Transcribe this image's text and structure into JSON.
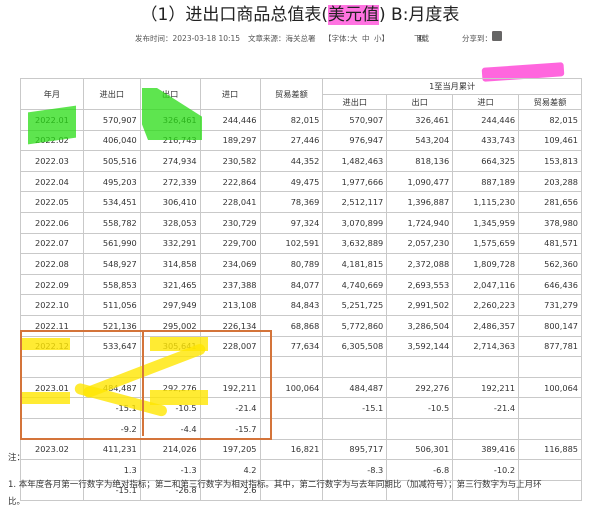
{
  "title": {
    "prefix": "（1）进出口商品总值表(",
    "highlight": "美元值",
    "suffix": ") B:月度表"
  },
  "meta": {
    "publish_time": "发布时间：2023-03-18 10:15",
    "source": "文章来源：海关总署",
    "font_label": "【字体：",
    "font_large": "大",
    "font_medium": "中",
    "font_small": "小】",
    "download": "下载",
    "share": "分享到："
  },
  "table": {
    "headers": {
      "month": "年月",
      "total": "进出口",
      "export": "出口",
      "import": "进口",
      "balance": "贸易差额",
      "cumulative_group": "1至当月累计",
      "cum_total": "进出口",
      "cum_export": "出口",
      "cum_import": "进口",
      "cum_balance": "贸易差额"
    },
    "rows": [
      {
        "month": "2022.01",
        "total": "570,907",
        "export": "326,461",
        "import": "244,446",
        "balance": "82,015",
        "cum_total": "570,907",
        "cum_export": "326,461",
        "cum_import": "244,446",
        "cum_balance": "82,015"
      },
      {
        "month": "2022.02",
        "total": "406,040",
        "export": "216,743",
        "import": "189,297",
        "balance": "27,446",
        "cum_total": "976,947",
        "cum_export": "543,204",
        "cum_import": "433,743",
        "cum_balance": "109,461"
      },
      {
        "month": "2022.03",
        "total": "505,516",
        "export": "274,934",
        "import": "230,582",
        "balance": "44,352",
        "cum_total": "1,482,463",
        "cum_export": "818,136",
        "cum_import": "664,325",
        "cum_balance": "153,813"
      },
      {
        "month": "2022.04",
        "total": "495,203",
        "export": "272,339",
        "import": "222,864",
        "balance": "49,475",
        "cum_total": "1,977,666",
        "cum_export": "1,090,477",
        "cum_import": "887,189",
        "cum_balance": "203,288"
      },
      {
        "month": "2022.05",
        "total": "534,451",
        "export": "306,410",
        "import": "228,041",
        "balance": "78,369",
        "cum_total": "2,512,117",
        "cum_export": "1,396,887",
        "cum_import": "1,115,230",
        "cum_balance": "281,656"
      },
      {
        "month": "2022.06",
        "total": "558,782",
        "export": "328,053",
        "import": "230,729",
        "balance": "97,324",
        "cum_total": "3,070,899",
        "cum_export": "1,724,940",
        "cum_import": "1,345,959",
        "cum_balance": "378,980"
      },
      {
        "month": "2022.07",
        "total": "561,990",
        "export": "332,291",
        "import": "229,700",
        "balance": "102,591",
        "cum_total": "3,632,889",
        "cum_export": "2,057,230",
        "cum_import": "1,575,659",
        "cum_balance": "481,571"
      },
      {
        "month": "2022.08",
        "total": "548,927",
        "export": "314,858",
        "import": "234,069",
        "balance": "80,789",
        "cum_total": "4,181,815",
        "cum_export": "2,372,088",
        "cum_import": "1,809,728",
        "cum_balance": "562,360"
      },
      {
        "month": "2022.09",
        "total": "558,853",
        "export": "321,465",
        "import": "237,388",
        "balance": "84,077",
        "cum_total": "4,740,669",
        "cum_export": "2,693,553",
        "cum_import": "2,047,116",
        "cum_balance": "646,436"
      },
      {
        "month": "2022.10",
        "total": "511,056",
        "export": "297,949",
        "import": "213,108",
        "balance": "84,843",
        "cum_total": "5,251,725",
        "cum_export": "2,991,502",
        "cum_import": "2,260,223",
        "cum_balance": "731,279"
      },
      {
        "month": "2022.11",
        "total": "521,136",
        "export": "295,002",
        "import": "226,134",
        "balance": "68,868",
        "cum_total": "5,772,860",
        "cum_export": "3,286,504",
        "cum_import": "2,486,357",
        "cum_balance": "800,147"
      },
      {
        "month": "2022.12",
        "total": "533,647",
        "export": "305,641",
        "import": "228,007",
        "balance": "77,634",
        "cum_total": "6,305,508",
        "cum_export": "3,592,144",
        "cum_import": "2,714,363",
        "cum_balance": "877,781"
      },
      {
        "month": "",
        "total": "",
        "export": "",
        "import": "",
        "balance": "",
        "cum_total": "",
        "cum_export": "",
        "cum_import": "",
        "cum_balance": ""
      },
      {
        "month": "2023.01",
        "total": "484,487",
        "export": "292,276",
        "import": "192,211",
        "balance": "100,064",
        "cum_total": "484,487",
        "cum_export": "292,276",
        "cum_import": "192,211",
        "cum_balance": "100,064"
      },
      {
        "month": "",
        "total": "-15.1",
        "export": "-10.5",
        "import": "-21.4",
        "balance": "",
        "cum_total": "-15.1",
        "cum_export": "-10.5",
        "cum_import": "-21.4",
        "cum_balance": ""
      },
      {
        "month": "",
        "total": "-9.2",
        "export": "-4.4",
        "import": "-15.7",
        "balance": "",
        "cum_total": "",
        "cum_export": "",
        "cum_import": "",
        "cum_balance": ""
      },
      {
        "month": "2023.02",
        "total": "411,231",
        "export": "214,026",
        "import": "197,205",
        "balance": "16,821",
        "cum_total": "895,717",
        "cum_export": "506,301",
        "cum_import": "389,416",
        "cum_balance": "116,885"
      },
      {
        "month": "",
        "total": "1.3",
        "export": "-1.3",
        "import": "4.2",
        "balance": "",
        "cum_total": "-8.3",
        "cum_export": "-6.8",
        "cum_import": "-10.2",
        "cum_balance": ""
      },
      {
        "month": "",
        "total": "-15.1",
        "export": "-26.8",
        "import": "2.6",
        "balance": "",
        "cum_total": "",
        "cum_export": "",
        "cum_import": "",
        "cum_balance": ""
      }
    ]
  },
  "notes": {
    "label": "注：",
    "line1": "1. 本年度各月第一行数字为绝对指标；第二和第三行数字为相对指标。其中，第二行数字为与去年同期比（加减符号）；第三行数字为与上月环",
    "line2": "比。"
  },
  "colors": {
    "green_highlight": "#28dc14",
    "yellow_highlight": "#ffe600",
    "magenta_highlight": "#ff00c8",
    "box_border": "#d4743a"
  }
}
